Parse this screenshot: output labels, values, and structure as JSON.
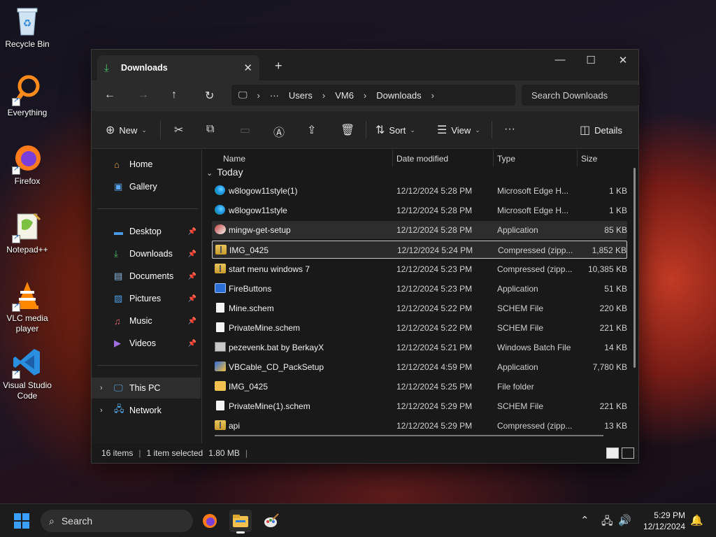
{
  "desktop": {
    "icons": [
      {
        "label": "Recycle Bin"
      },
      {
        "label": "Everything"
      },
      {
        "label": "Firefox"
      },
      {
        "label": "Notepad++"
      },
      {
        "label": "VLC media player"
      },
      {
        "label": "Visual Studio Code"
      }
    ]
  },
  "window": {
    "tab_title": "Downloads",
    "new_tab": "+",
    "controls": {
      "minimize": "—",
      "maximize": "☐",
      "close": "✕"
    }
  },
  "nav": {
    "back": "←",
    "forward": "→",
    "up": "↑",
    "refresh": "↻",
    "breadcrumb": [
      "Users",
      "VM6",
      "Downloads"
    ],
    "overflow": "···",
    "search_placeholder": "Search Downloads"
  },
  "toolbar": {
    "new_label": "New",
    "sort_label": "Sort",
    "view_label": "View",
    "more_label": "···",
    "details_label": "Details"
  },
  "sidebar": {
    "items": [
      {
        "label": "Home",
        "pinned": false
      },
      {
        "label": "Gallery",
        "pinned": false
      },
      {
        "label": "Desktop",
        "pinned": true
      },
      {
        "label": "Downloads",
        "pinned": true
      },
      {
        "label": "Documents",
        "pinned": true
      },
      {
        "label": "Pictures",
        "pinned": true
      },
      {
        "label": "Music",
        "pinned": true
      },
      {
        "label": "Videos",
        "pinned": true
      },
      {
        "label": "This PC",
        "pinned": false
      },
      {
        "label": "Network",
        "pinned": false
      }
    ]
  },
  "files": {
    "columns": {
      "name": "Name",
      "date": "Date modified",
      "type": "Type",
      "size": "Size"
    },
    "group": "Today",
    "rows": [
      {
        "name": "w8logow11style(1)",
        "date": "12/12/2024 5:28 PM",
        "type": "Microsoft Edge H...",
        "size": "1 KB",
        "icon": "edge-icon"
      },
      {
        "name": "w8logow11style",
        "date": "12/12/2024 5:28 PM",
        "type": "Microsoft Edge H...",
        "size": "1 KB",
        "icon": "edge-icon"
      },
      {
        "name": "mingw-get-setup",
        "date": "12/12/2024 5:28 PM",
        "type": "Application",
        "size": "85 KB",
        "icon": "setup-icon"
      },
      {
        "name": "IMG_0425",
        "date": "12/12/2024 5:24 PM",
        "type": "Compressed (zipp...",
        "size": "1,852 KB",
        "icon": "zip-icon"
      },
      {
        "name": "start menu windows 7",
        "date": "12/12/2024 5:23 PM",
        "type": "Compressed (zipp...",
        "size": "10,385 KB",
        "icon": "zip-icon"
      },
      {
        "name": "FireButtons",
        "date": "12/12/2024 5:23 PM",
        "type": "Application",
        "size": "51 KB",
        "icon": "app-icon"
      },
      {
        "name": "Mine.schem",
        "date": "12/12/2024 5:22 PM",
        "type": "SCHEM File",
        "size": "220 KB",
        "icon": "file-icon"
      },
      {
        "name": "PrivateMine.schem",
        "date": "12/12/2024 5:22 PM",
        "type": "SCHEM File",
        "size": "221 KB",
        "icon": "file-icon"
      },
      {
        "name": "pezevenk.bat by BerkayX",
        "date": "12/12/2024 5:21 PM",
        "type": "Windows Batch File",
        "size": "14 KB",
        "icon": "bat-icon"
      },
      {
        "name": "VBCable_CD_PackSetup",
        "date": "12/12/2024 4:59 PM",
        "type": "Application",
        "size": "7,780 KB",
        "icon": "vbcable-icon"
      },
      {
        "name": "IMG_0425",
        "date": "12/12/2024 5:25 PM",
        "type": "File folder",
        "size": "",
        "icon": "folder-icon"
      },
      {
        "name": "PrivateMine(1).schem",
        "date": "12/12/2024 5:29 PM",
        "type": "SCHEM File",
        "size": "221 KB",
        "icon": "file-icon"
      },
      {
        "name": "api",
        "date": "12/12/2024 5:29 PM",
        "type": "Compressed (zipp...",
        "size": "13 KB",
        "icon": "zip-icon"
      }
    ]
  },
  "status": {
    "items": "16 items",
    "selected": "1 item selected",
    "size": "1.80 MB",
    "sep": "|"
  },
  "taskbar": {
    "search_label": "Search",
    "time": "5:29 PM",
    "date": "12/12/2024"
  },
  "colors": {
    "accent": "#3aa0ff",
    "downloads_icon": "#46c46a"
  }
}
